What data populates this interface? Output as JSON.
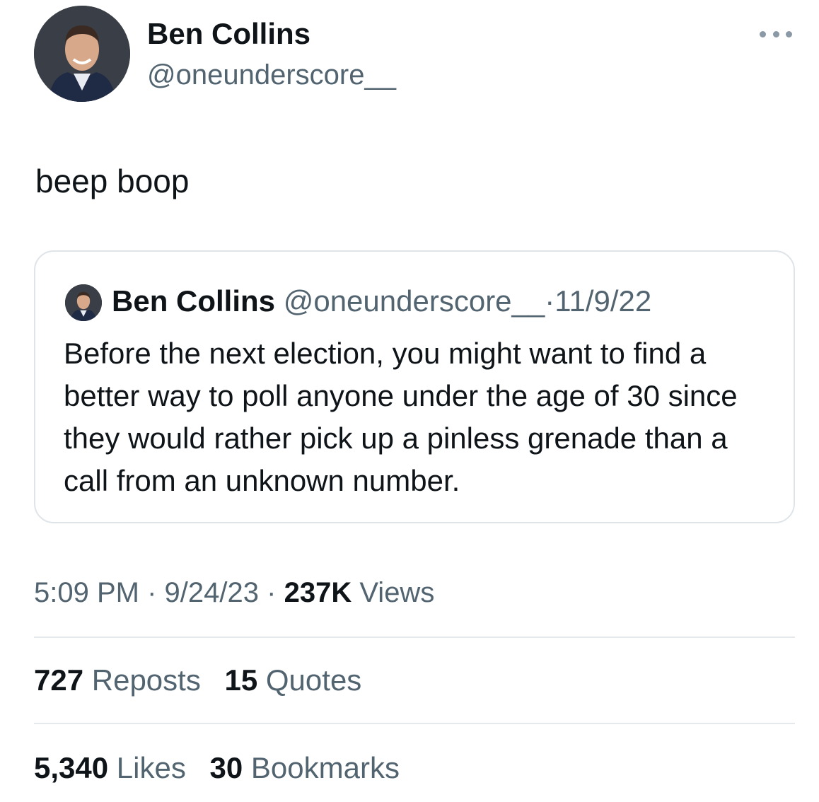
{
  "tweet": {
    "author_name": "Ben Collins",
    "author_handle": "@oneunderscore__",
    "more_icon": "more-horizontal-icon",
    "text": "beep boop",
    "quote": {
      "author_name": "Ben Collins",
      "author_handle": "@oneunderscore__",
      "separator": "·",
      "date": "11/9/22",
      "text": "Before the next election, you might want to find a better way to poll anyone under the age of 30 since they would rather pick up a pinless grenade than a call from an unknown number."
    },
    "time": "5:09 PM",
    "date": "9/24/23",
    "separator": "·",
    "views_count": "237K",
    "views_label": "Views",
    "stats": {
      "reposts_count": "727",
      "reposts_label": "Reposts",
      "quotes_count": "15",
      "quotes_label": "Quotes",
      "likes_count": "5,340",
      "likes_label": "Likes",
      "bookmarks_count": "30",
      "bookmarks_label": "Bookmarks"
    }
  },
  "colors": {
    "text_primary": "#0f1419",
    "text_secondary": "#536471",
    "border": "#dfe4e8"
  }
}
